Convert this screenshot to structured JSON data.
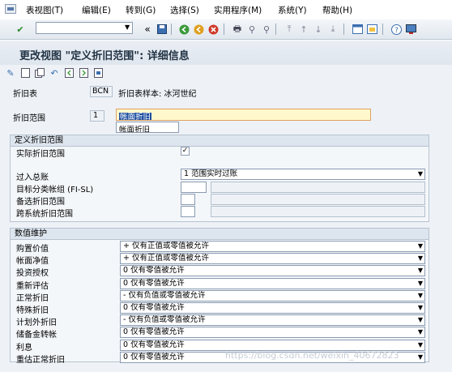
{
  "menu": {
    "items": [
      "表视图(T)",
      "编辑(E)",
      "转到(G)",
      "选择(S)",
      "实用程序(M)",
      "系统(Y)",
      "帮助(H)"
    ]
  },
  "toolbar": {
    "command_field_value": "",
    "back_label": "«"
  },
  "title": "更改视图 \"定义折旧范围\": 详细信息",
  "header": {
    "chart_label": "折旧表",
    "chart_value": "BCN",
    "chart_desc": "折旧表样本: 冰河世纪",
    "area_label": "折旧范围",
    "area_value": "1",
    "area_name": "帐面折旧",
    "area_short": "帐面折旧"
  },
  "define_group": {
    "title": "定义折旧范围",
    "real_area_label": "实际折旧范围",
    "real_area_checked": true,
    "post_gl_label": "过入总账",
    "post_gl_value": "1 范围实时过账",
    "target_ledger_label": "目标分类帐组 (FI-SL)",
    "alt_area_label": "备选折旧范围",
    "cross_area_label": "跨系统折旧范围"
  },
  "values_group": {
    "title": "数值维护",
    "rows": [
      {
        "label": "购置价值",
        "value": "+ 仅有正值或零值被允许"
      },
      {
        "label": "帐面净值",
        "value": "+ 仅有正值或零值被允许"
      },
      {
        "label": "投资授权",
        "value": "0 仅有零值被允许"
      },
      {
        "label": "重新评估",
        "value": "0 仅有零值被允许"
      },
      {
        "label": "正常折旧",
        "value": "- 仅有负值或零值被允许"
      },
      {
        "label": "特殊折旧",
        "value": "0 仅有零值被允许"
      },
      {
        "label": "计划外折旧",
        "value": "- 仅有负值或零值被允许"
      },
      {
        "label": "储备金转帐",
        "value": "0 仅有零值被允许"
      },
      {
        "label": "利息",
        "value": "0 仅有零值被允许"
      },
      {
        "label": "重估正常折旧",
        "value": "0 仅有零值被允许"
      }
    ]
  },
  "watermark": "https://blog.csdn.net/weixin_40672823"
}
